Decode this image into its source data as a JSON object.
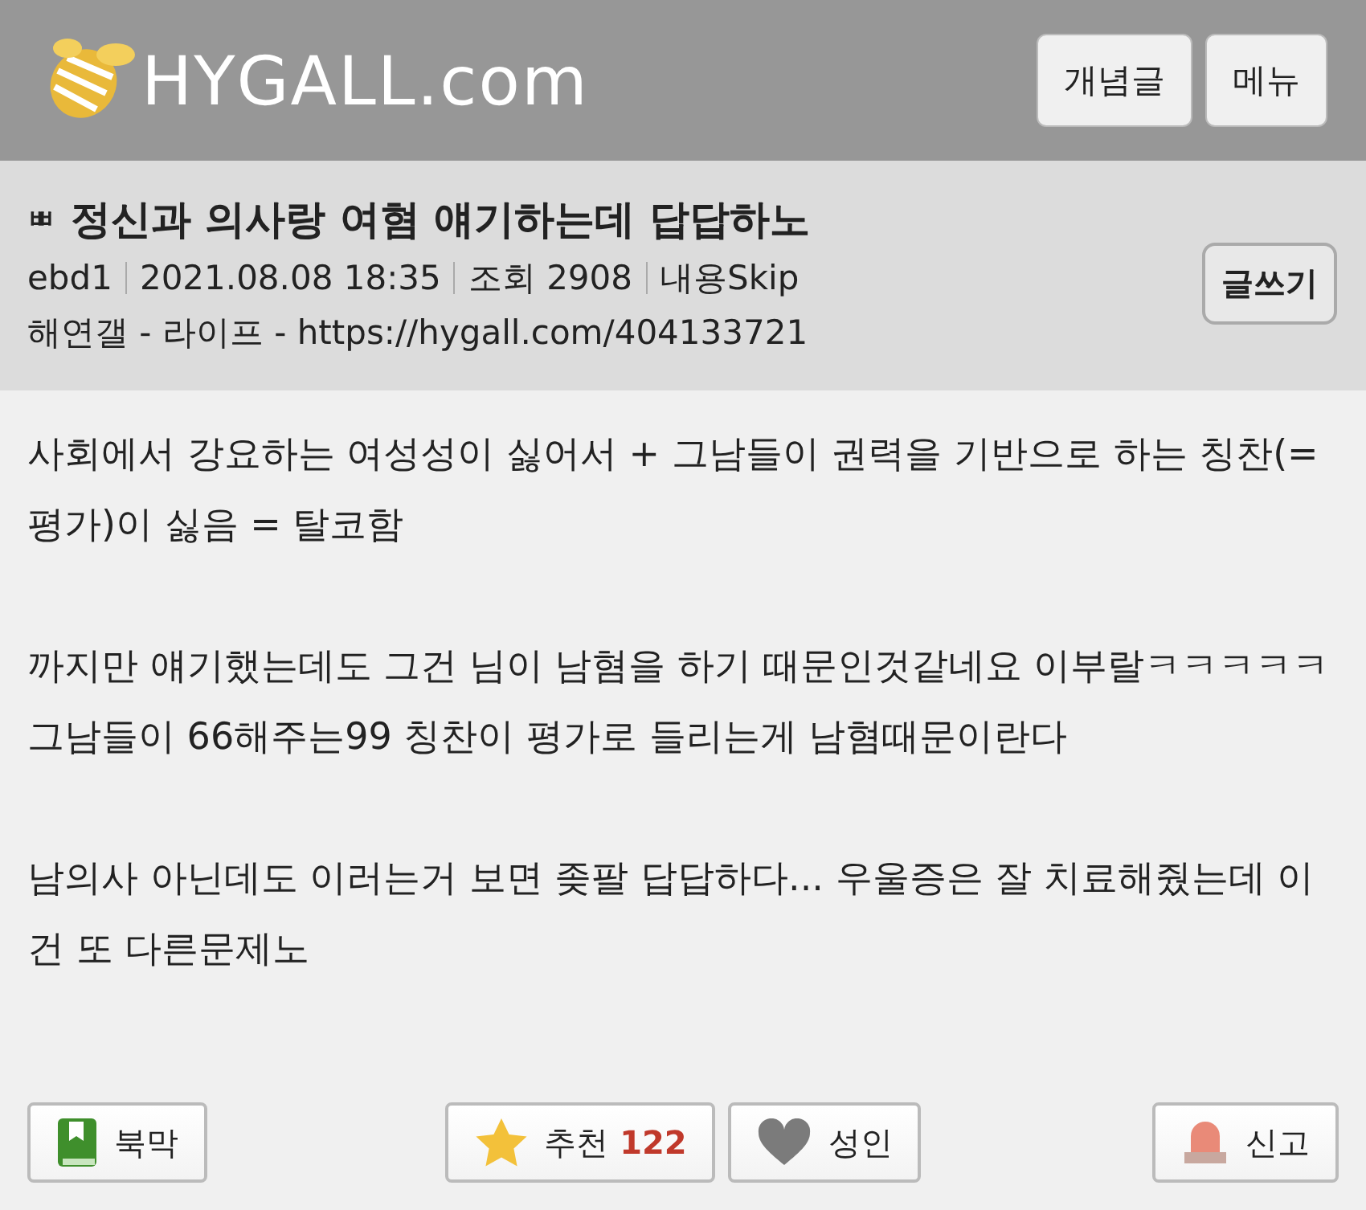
{
  "header": {
    "logo": "HYGALL.com",
    "buttons": [
      "개념글",
      "메뉴"
    ]
  },
  "post": {
    "mark": "ㅃ",
    "title": "정신과 의사랑 여혐 얘기하는데 답답하노",
    "meta": [
      "ebd1",
      "2021.08.08 18:35",
      "조회 2908",
      "내용Skip"
    ],
    "breadcrumb": "해연갤 - 라이프 - https://hygall.com/404133721",
    "write_button": "글쓰기"
  },
  "body": [
    "사회에서 강요하는 여성성이 싫어서 + 그남들이 권력을 기반으로 하는 칭찬(=평가)이 싫음 = 탈코함",
    "까지만 얘기했는데도 그건 님이 남혐을 하기 때문인것같네요 이부랄ㅋㅋㅋㅋㅋ 그남들이 66해주는99 칭찬이 평가로 들리는게 남혐때문이란다",
    "남의사 아닌데도 이러는거 보면 좆팔 답답하다... 우울증은 잘 치료해줬는데 이건 또 다른문제노"
  ],
  "actions": [
    {
      "kind": "bookmark",
      "label": "북막"
    },
    {
      "kind": "recommend",
      "label": "추천",
      "count": "122"
    },
    {
      "kind": "adult",
      "label": "성인"
    },
    {
      "kind": "report",
      "label": "신고"
    }
  ]
}
